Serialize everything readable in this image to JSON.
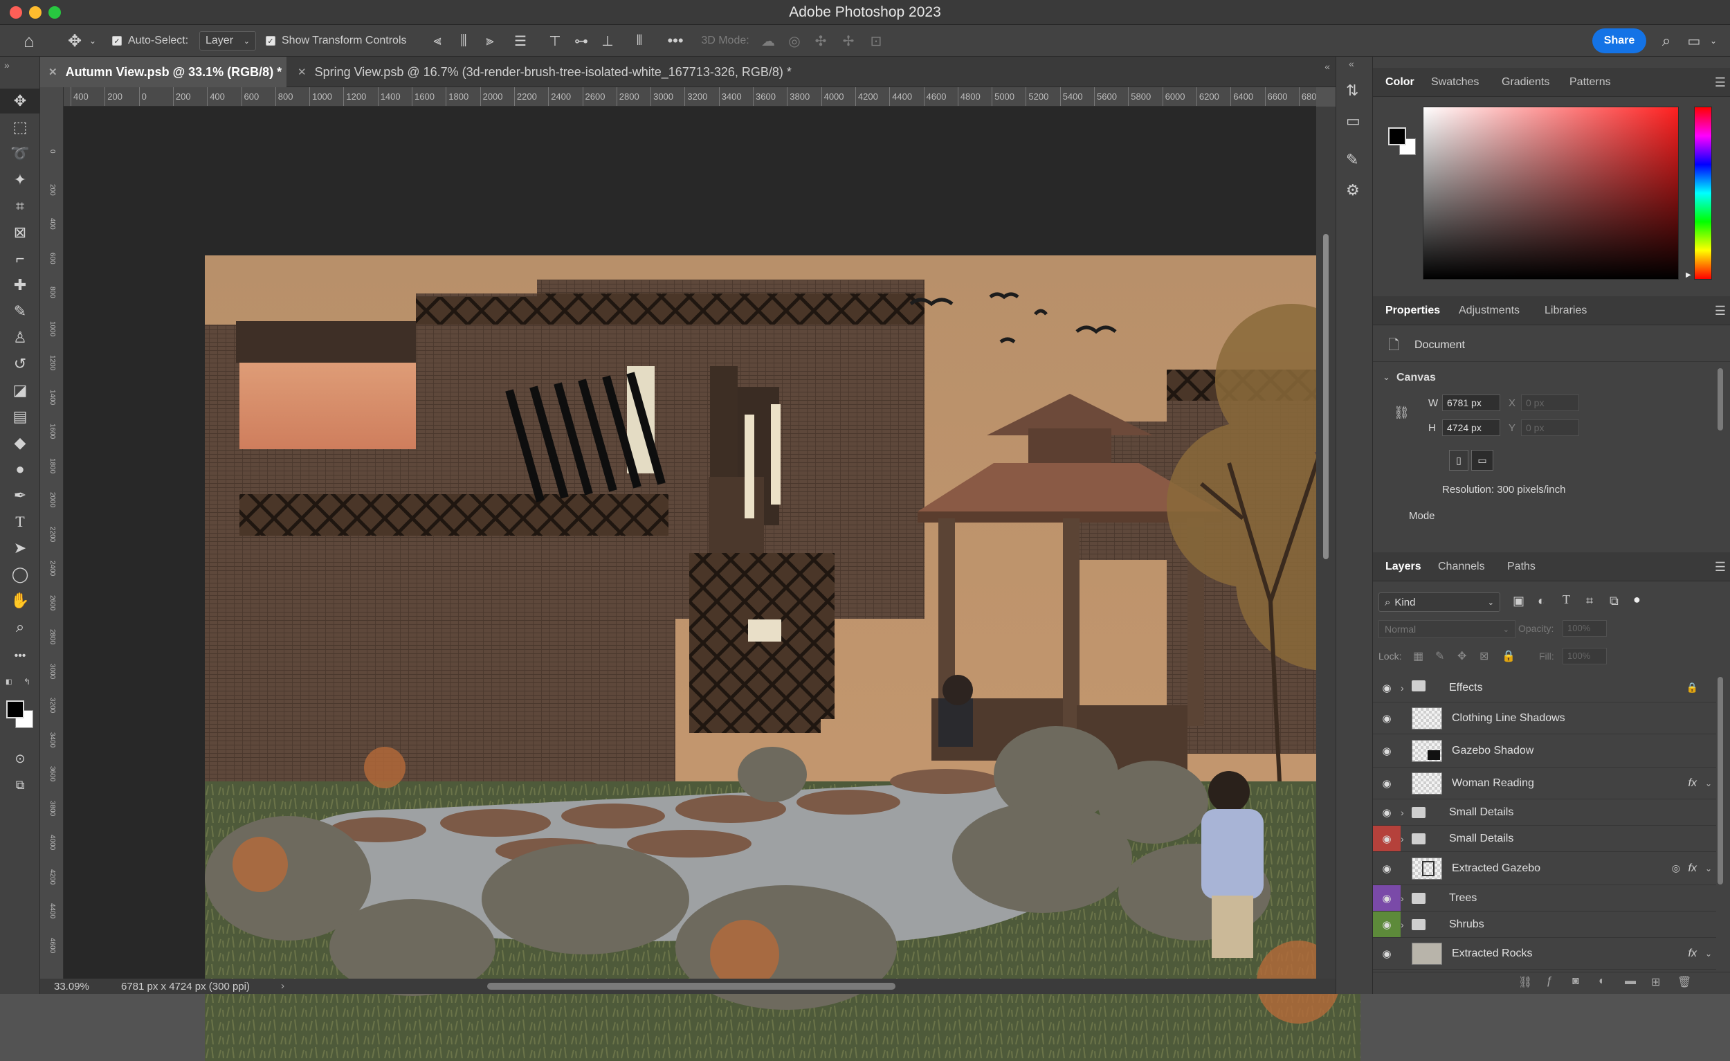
{
  "app": {
    "title": "Adobe Photoshop 2023"
  },
  "options_bar": {
    "auto_select_label": "Auto-Select:",
    "auto_select_value": "Layer",
    "show_transform_label": "Show Transform Controls",
    "mode3d_label": "3D Mode:",
    "share_label": "Share"
  },
  "tabs": [
    {
      "label": "Autumn View.psb @ 33.1% (RGB/8) *",
      "active": true
    },
    {
      "label": "Spring View.psb @ 16.7% (3d-render-brush-tree-isolated-white_167713-326, RGB/8) *",
      "active": false
    }
  ],
  "ruler_h": [
    "400",
    "200",
    "0",
    "200",
    "400",
    "600",
    "800",
    "1000",
    "1200",
    "1400",
    "1600",
    "1800",
    "2000",
    "2200",
    "2400",
    "2600",
    "2800",
    "3000",
    "3200",
    "3400",
    "3600",
    "3800",
    "4000",
    "4200",
    "4400",
    "4600",
    "4800",
    "5000",
    "5200",
    "5400",
    "5600",
    "5800",
    "6000",
    "6200",
    "6400",
    "6600",
    "680"
  ],
  "ruler_v": [
    "0",
    "2 0 0",
    "4 0 0",
    "6 0 0",
    "8 0 0",
    "1 0 0 0",
    "1 2 0 0",
    "1 4 0 0",
    "1 6 0 0",
    "1 8 0 0",
    "2 0 0 0",
    "2 2 0 0",
    "2 4 0 0",
    "2 6 0 0",
    "2 8 0 0",
    "3 0 0 0",
    "3 2 0 0",
    "3 4 0 0",
    "3 6 0 0",
    "3 8 0 0",
    "4 0 0 0",
    "4 2 0 0",
    "4 4 0 0",
    "4 6 0 0"
  ],
  "status": {
    "zoom": "33.09%",
    "doc_info": "6781 px x 4724 px (300 ppi)"
  },
  "color_panel": {
    "tabs": [
      "Color",
      "Swatches",
      "Gradients",
      "Patterns"
    ],
    "hue_hex": "#ff2020"
  },
  "properties_panel": {
    "tabs": [
      "Properties",
      "Adjustments",
      "Libraries"
    ],
    "section": "Document",
    "canvas_label": "Canvas",
    "w_label": "W",
    "w_value": "6781 px",
    "h_label": "H",
    "h_value": "4724 px",
    "x_label": "X",
    "x_value": "0 px",
    "y_label": "Y",
    "y_value": "0 px",
    "resolution": "Resolution: 300 pixels/inch",
    "mode_label": "Mode"
  },
  "layers_panel": {
    "tabs": [
      "Layers",
      "Channels",
      "Paths"
    ],
    "kind_label": "Kind",
    "blend_mode": "Normal",
    "opacity_label": "Opacity:",
    "opacity_value": "100%",
    "lock_label": "Lock:",
    "fill_label": "Fill:",
    "fill_value": "100%",
    "layers": [
      {
        "name": "Effects",
        "type": "group",
        "locked": true
      },
      {
        "name": "Clothing Line Shadows",
        "type": "layer"
      },
      {
        "name": "Gazebo Shadow",
        "type": "layer"
      },
      {
        "name": "Woman Reading",
        "type": "layer",
        "fx": "fx"
      },
      {
        "name": "Small Details",
        "type": "group"
      },
      {
        "name": "Small Details",
        "type": "group",
        "eye_color": "#b5413b"
      },
      {
        "name": "Extracted Gazebo",
        "type": "layer",
        "fx": "fx"
      },
      {
        "name": "Trees",
        "type": "group",
        "eye_color": "#7a4aa8"
      },
      {
        "name": "Shrubs",
        "type": "group",
        "eye_color": "#5d8a3a"
      },
      {
        "name": "Extracted Rocks",
        "type": "layer",
        "fx": "fx"
      }
    ]
  }
}
